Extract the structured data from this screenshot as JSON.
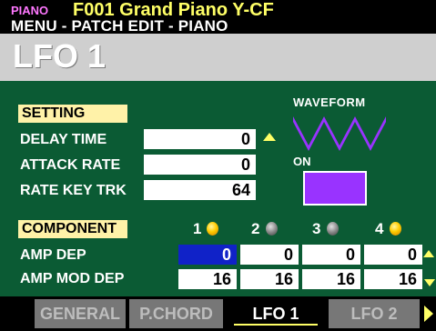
{
  "header": {
    "category": "PIANO",
    "program": "F001 Grand Piano Y-CF",
    "breadcrumb": "MENU - PATCH EDIT - PIANO"
  },
  "page_title": "LFO 1",
  "setting": {
    "heading": "SETTING",
    "rows": [
      {
        "label": "DELAY TIME",
        "value": "0"
      },
      {
        "label": "ATTACK RATE",
        "value": "0"
      },
      {
        "label": "RATE KEY TRK",
        "value": "64"
      }
    ]
  },
  "waveform": {
    "label": "WAVEFORM",
    "shape": "triangle",
    "color": "#9933ff",
    "on_label": "ON",
    "on_color": "#9933ff"
  },
  "component": {
    "heading": "COMPONENT",
    "columns": [
      {
        "num": "1",
        "lamp": "on"
      },
      {
        "num": "2",
        "lamp": "off"
      },
      {
        "num": "3",
        "lamp": "off"
      },
      {
        "num": "4",
        "lamp": "on"
      }
    ],
    "rows": [
      {
        "label": "AMP DEP",
        "values": [
          "0",
          "0",
          "0",
          "0"
        ]
      },
      {
        "label": "AMP MOD DEP",
        "values": [
          "16",
          "16",
          "16",
          "16"
        ]
      }
    ]
  },
  "tabs": [
    {
      "label": "GENERAL",
      "active": false
    },
    {
      "label": "P.CHORD",
      "active": false
    },
    {
      "label": "LFO 1",
      "active": true
    },
    {
      "label": "LFO 2",
      "active": false
    }
  ],
  "colors": {
    "background": "#0b5b34",
    "accent_yellow": "#ffff66",
    "selected_blue": "#1022c8",
    "lamp_on": "#ffcc00",
    "lamp_off": "#8a8a8a"
  }
}
